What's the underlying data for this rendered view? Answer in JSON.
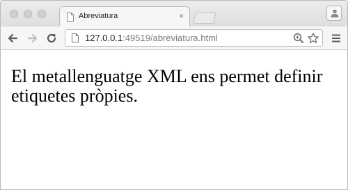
{
  "browser": {
    "tab": {
      "title": "Abreviatura",
      "close_glyph": "×",
      "icon": "page-icon"
    },
    "toolbar": {
      "back_icon": "back-arrow-icon",
      "forward_icon": "forward-arrow-icon",
      "reload_icon": "reload-icon",
      "menu_icon": "hamburger-menu-icon"
    },
    "address": {
      "host": "127.0.0.1",
      "rest": ":49519/abreviatura.html",
      "zoom_icon": "zoom-icon",
      "bookmark_icon": "star-icon"
    },
    "profile_icon": "person-icon"
  },
  "page": {
    "text": "El metallenguatge XML ens permet definir etiquetes pròpies."
  },
  "colors": {
    "tabstrip": "#dedede",
    "toolbar": "#f6f6f6",
    "url_rest": "#7a7a7a"
  }
}
